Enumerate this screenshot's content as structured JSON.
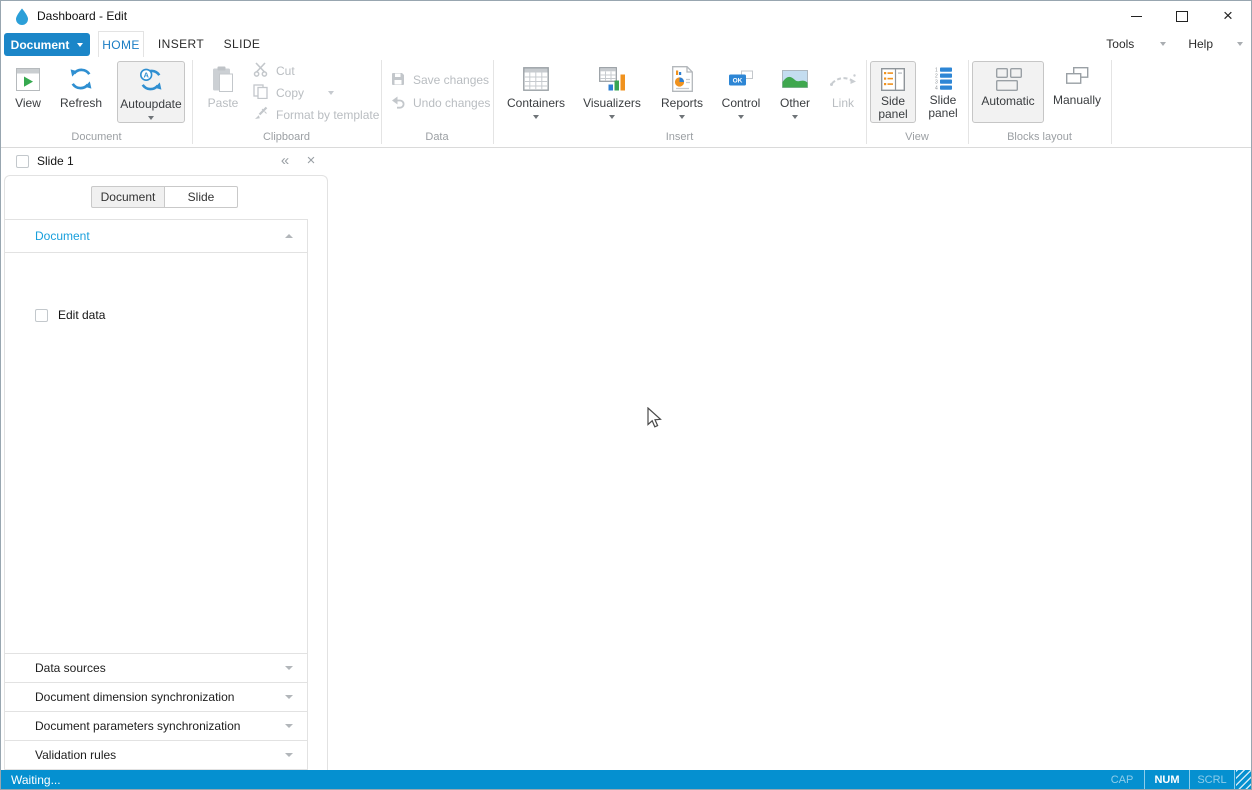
{
  "window": {
    "title": "Dashboard - Edit"
  },
  "menubar": {
    "document_button": {
      "label": "Document"
    },
    "tabs": [
      {
        "label": "HOME",
        "active": true
      },
      {
        "label": "INSERT",
        "active": false
      },
      {
        "label": "SLIDE",
        "active": false
      }
    ],
    "tools": {
      "label": "Tools"
    },
    "help": {
      "label": "Help"
    }
  },
  "ribbon": {
    "document": {
      "group_label": "Document",
      "view": "View",
      "refresh": "Refresh",
      "autoupdate": "Autoupdate",
      "autoupdate_selected": true
    },
    "clipboard": {
      "group_label": "Clipboard",
      "paste": "Paste",
      "cut": "Cut",
      "copy": "Copy",
      "format_by_template": "Format by template",
      "disabled": true
    },
    "data": {
      "group_label": "Data",
      "save_changes": "Save changes",
      "undo_changes": "Undo changes",
      "disabled": true
    },
    "insert": {
      "group_label": "Insert",
      "containers": "Containers",
      "visualizers": "Visualizers",
      "reports": "Reports",
      "control": "Control",
      "control_ok": "OK",
      "other": "Other",
      "link": "Link",
      "link_disabled": true
    },
    "view": {
      "group_label": "View",
      "side_panel": "Side panel",
      "side_panel_selected": true,
      "slide_panel": "Slide panel"
    },
    "blocks_layout": {
      "group_label": "Blocks layout",
      "automatic": "Automatic",
      "automatic_selected": true,
      "manually": "Manually"
    }
  },
  "slide_strip": {
    "slide_label": "Slide 1",
    "collapse_glyph": "«",
    "close_glyph": "×"
  },
  "side_panel": {
    "mode_tabs": [
      {
        "label": "Document",
        "active": true
      },
      {
        "label": "Slide",
        "active": false
      }
    ],
    "document_section": {
      "label": "Document",
      "expanded": true,
      "edit_data_label": "Edit data",
      "edit_data_checked": false
    },
    "collapsed_sections": [
      {
        "label": "Data sources"
      },
      {
        "label": "Document dimension synchronization"
      },
      {
        "label": "Document parameters synchronization"
      },
      {
        "label": "Validation rules"
      }
    ]
  },
  "status_bar": {
    "message": "Waiting...",
    "keys": [
      {
        "label": "CAP",
        "active": false
      },
      {
        "label": "NUM",
        "active": true
      },
      {
        "label": "SCRL",
        "active": false
      }
    ]
  },
  "icons": {
    "app": "water-drop",
    "minimize": "horizontal-line",
    "maximize": "square-outline",
    "close": "x-mark",
    "view": "green-play-in-frame",
    "refresh": "blue-circular-arrows",
    "autoupdate": "blue-circular-arrows-with-A-badge",
    "paste": "clipboard",
    "cut": "scissors",
    "copy": "two-pages",
    "format_by_template": "brush",
    "save_changes": "floppy-disk",
    "undo_changes": "undo-arrow",
    "containers": "grid-table",
    "visualizers": "table-with-bars",
    "reports": "page-with-pie-chart",
    "control": "ok-button",
    "other": "picture-landscape",
    "link": "dashed-link-arrow",
    "side_panel": "panel-with-orange-list",
    "slide_panel": "numbered-blue-list",
    "slide_panel_numbers": [
      "1",
      "2",
      "3",
      "4"
    ],
    "automatic": "blocks-grid-outline",
    "manually": "overlapping-rectangles"
  },
  "colors": {
    "accent_blue": "#1b86c8",
    "active_tab_blue": "#1a7dc4",
    "panel_section_blue": "#189fdc",
    "status_bar_blue": "#0590d0",
    "selected_button_bg": "#f2f2f2",
    "disabled_text": "#b9bdc1",
    "icon_orange": "#f0921e",
    "icon_green": "#38a553",
    "icon_blue": "#2d7fd3"
  }
}
